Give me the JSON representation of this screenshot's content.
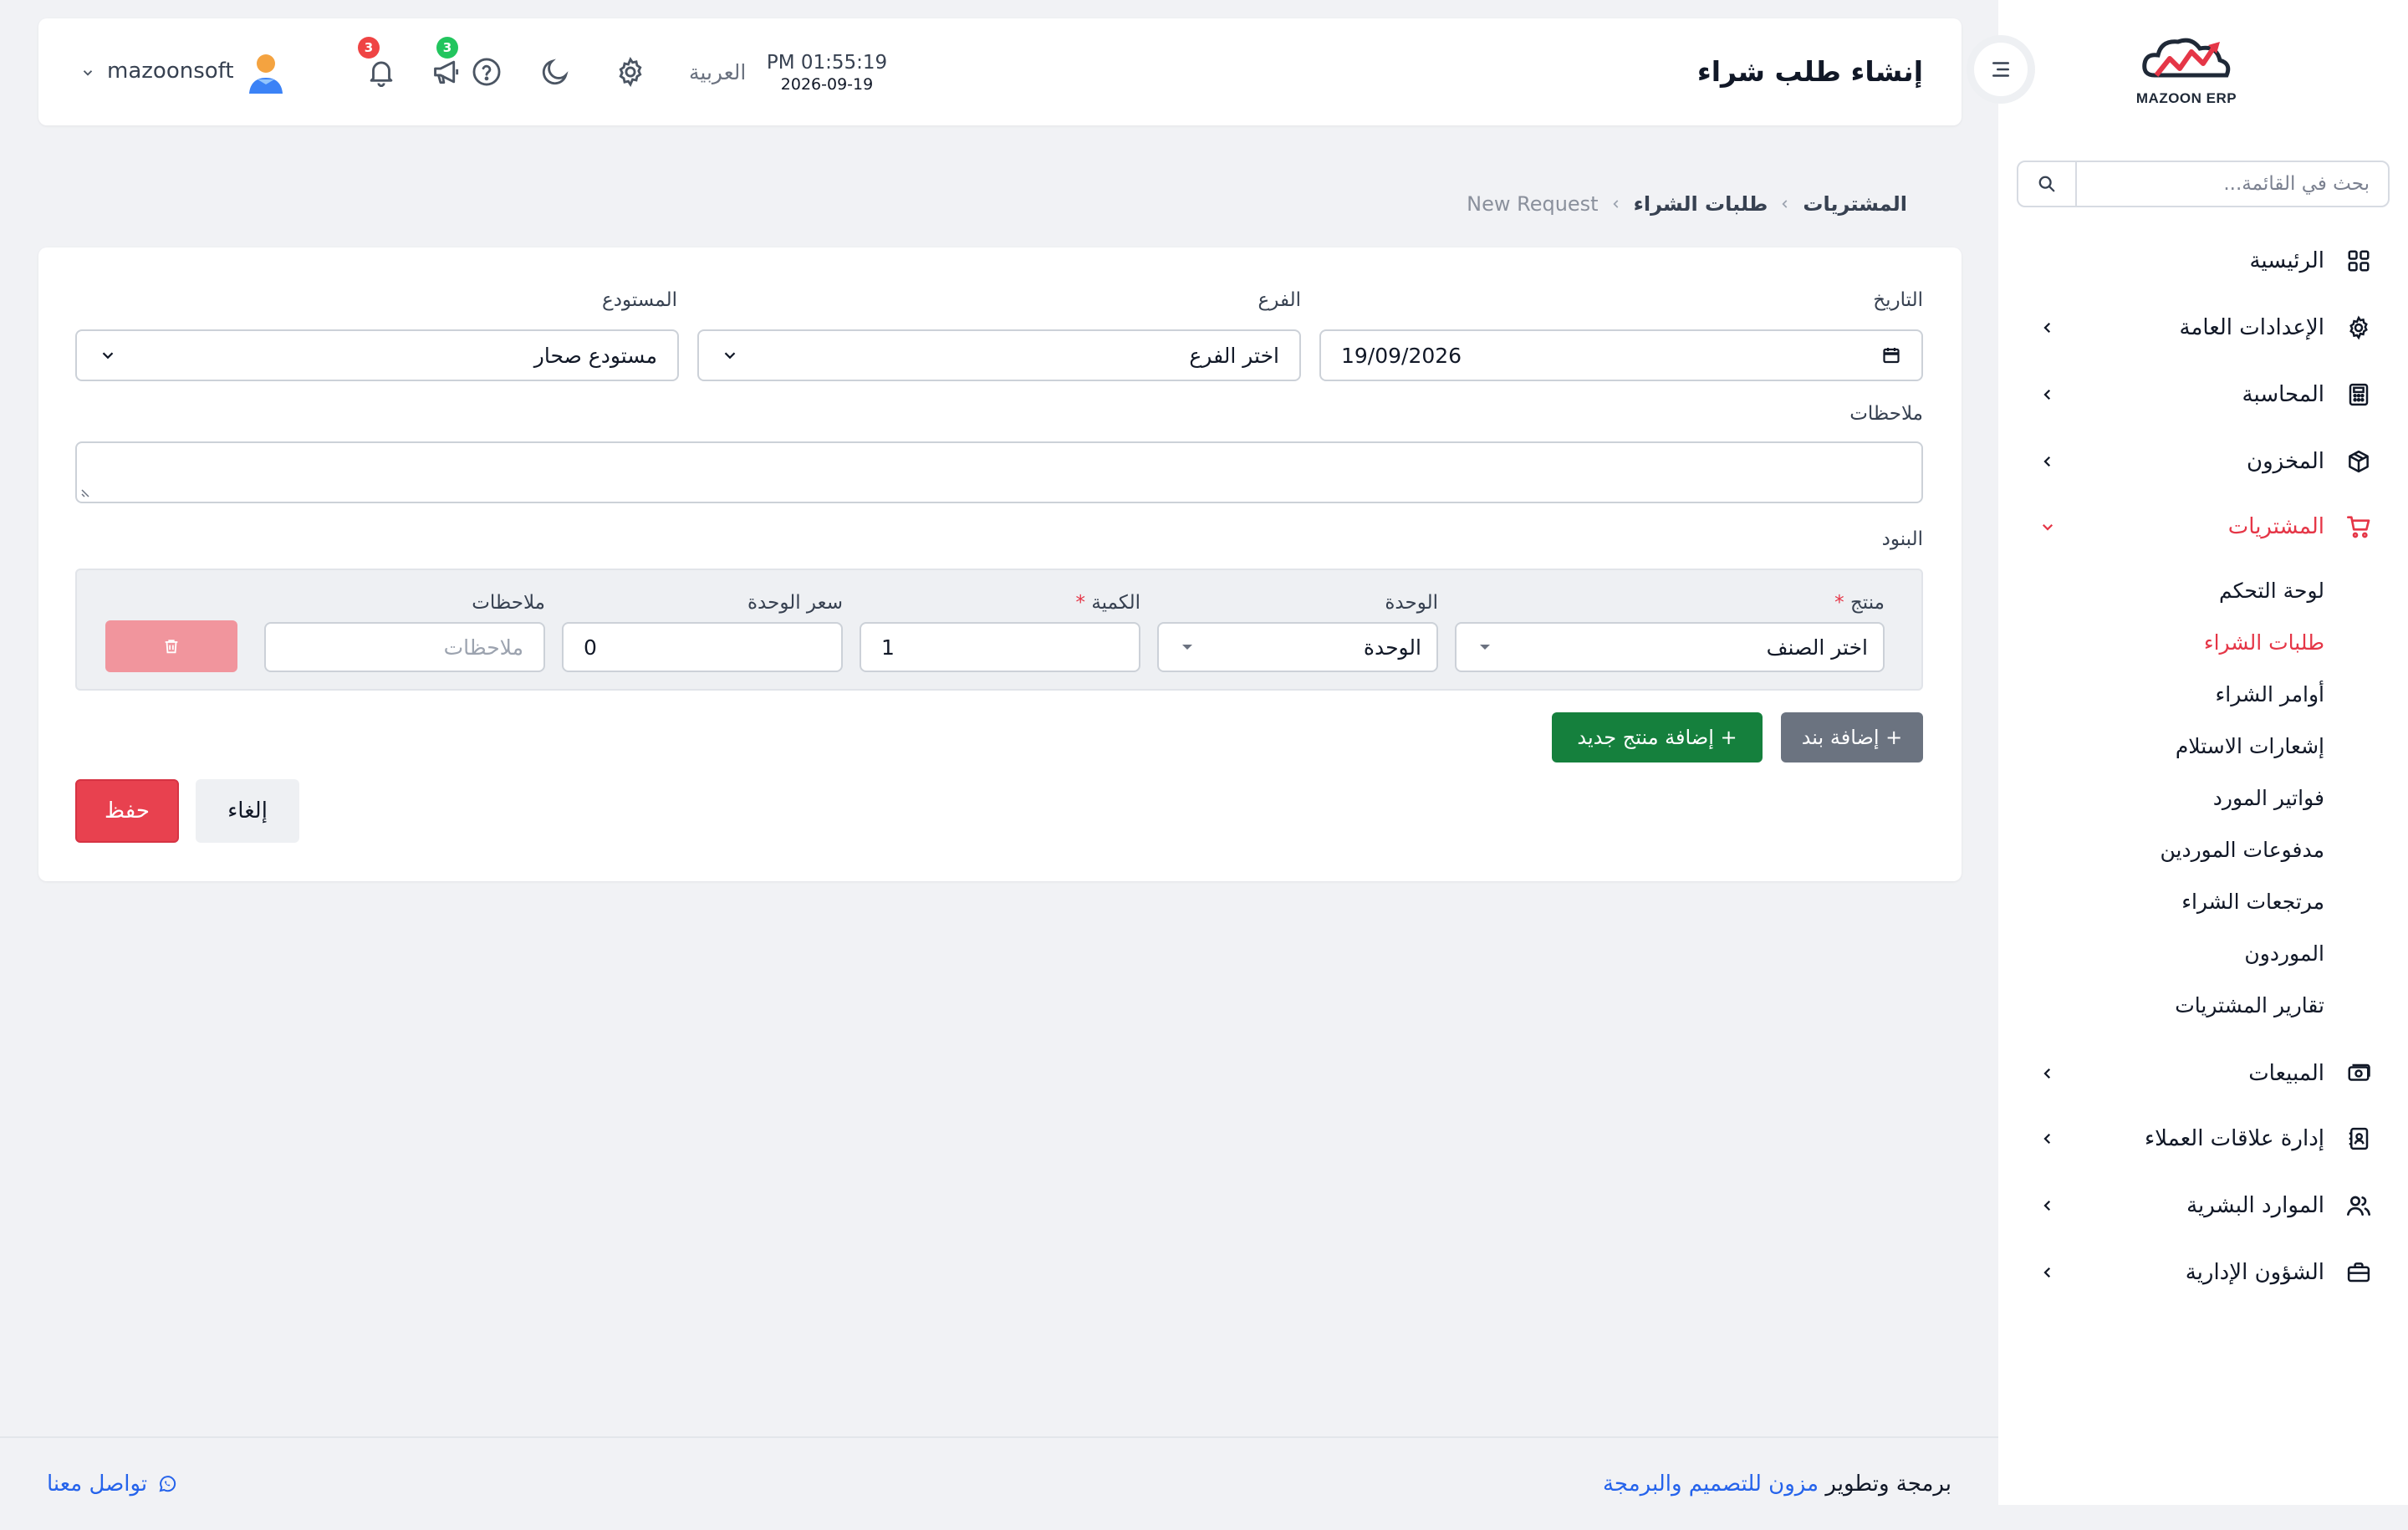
{
  "sidebar": {
    "logo_text": "MAZOON ERP",
    "logo_tag": "ERP",
    "search_placeholder": "بحث في القائمة...",
    "items": [
      {
        "label": "الرئيسية",
        "icon": "grid-icon"
      },
      {
        "label": "الإعدادات العامة",
        "icon": "gear-icon"
      },
      {
        "label": "المحاسبة",
        "icon": "calculator-icon"
      },
      {
        "label": "المخزون",
        "icon": "box-icon"
      },
      {
        "label": "المشتريات",
        "icon": "cart-icon"
      },
      {
        "label": "المبيعات",
        "icon": "cash-icon"
      },
      {
        "label": "إدارة علاقات العملاء",
        "icon": "contacts-icon"
      },
      {
        "label": "الموارد البشرية",
        "icon": "users-icon"
      },
      {
        "label": "الشؤون الإدارية",
        "icon": "briefcase-icon"
      }
    ],
    "purchases_sub": [
      "لوحة التحكم",
      "طلبات الشراء",
      "أوامر الشراء",
      "إشعارات الاستلام",
      "فواتير المورد",
      "مدفوعات الموردين",
      "مرتجعات الشراء",
      "الموردون",
      "تقارير المشتريات"
    ]
  },
  "header": {
    "title": "إنشاء طلب شراء",
    "time": "PM 01:55:19",
    "date": "2026-09-19",
    "language": "العربية",
    "announcements_count": "3",
    "notifications_count": "3",
    "username": "mazoonsoft"
  },
  "breadcrumb": [
    "المشتريات",
    "طلبات الشراء",
    "New Request"
  ],
  "form": {
    "date_label": "التاريخ",
    "date_value": "19/09/2026",
    "branch_label": "الفرع",
    "branch_value": "اختر الفرع",
    "warehouse_label": "المستودع",
    "warehouse_value": "مستودع صحار",
    "notes_label": "ملاحظات",
    "items_label": "البنود",
    "item": {
      "product_label": "منتج",
      "product_value": "اختر الصنف",
      "unit_label": "الوحدة",
      "unit_value": "الوحدة",
      "qty_label": "الكمية",
      "qty_value": "1",
      "price_label": "سعر الوحدة",
      "price_value": "0",
      "notes_label": "ملاحظات",
      "notes_placeholder": "ملاحظات"
    },
    "add_item": "+ إضافة بند",
    "add_product": "+ إضافة منتج جديد",
    "cancel": "إلغاء",
    "save": "حفظ"
  },
  "footer": {
    "credit_prefix": "برمجة وتطوير",
    "credit_link": "مزون للتصميم والبرمجة",
    "contact": "تواصل معنا"
  },
  "colors": {
    "accent_red": "#e53647",
    "save_red": "#e8414f",
    "add_green": "#15803d",
    "add_gray": "#6b7380",
    "badge_red": "#ef4444",
    "badge_green": "#22c55e",
    "link_blue": "#2563eb"
  }
}
